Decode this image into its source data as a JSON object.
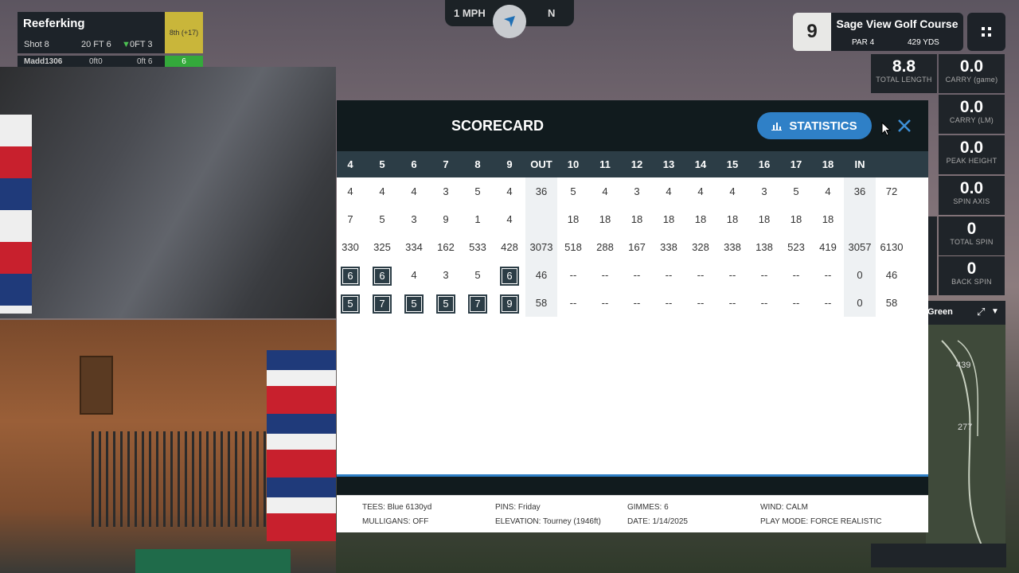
{
  "player_panel": {
    "name": "Reeferking",
    "shot": "Shot 8",
    "distance": "20 FT 6",
    "offset": "0FT 3",
    "place": "8th (+17)",
    "next_player": "Madd1306",
    "next_a": "0ft0",
    "next_b": "0ft 6",
    "next_score": "6"
  },
  "wind": {
    "speed": "1 MPH",
    "direction": "N"
  },
  "hole": {
    "number": "9",
    "course": "Sage View Golf Course",
    "par": "PAR 4",
    "yards": "429 YDS"
  },
  "shot_stats": [
    {
      "value": "8.8",
      "label": "TOTAL LENGTH"
    },
    {
      "value": "0.0",
      "label": "CARRY (game)"
    },
    {
      "value": "0.0",
      "label": "CARRY (LM)"
    },
    {
      "value": "0.0",
      "label": "PEAK HEIGHT"
    },
    {
      "value": "0.0",
      "label": "SPIN AXIS"
    },
    {
      "value": "0",
      "label": "TOTAL SPIN"
    },
    {
      "value": "0",
      "label": "BACK SPIN"
    }
  ],
  "map": {
    "label": "Green",
    "dist1": "439",
    "dist2": "277"
  },
  "scorecard": {
    "title": "SCORECARD",
    "statistics_label": "STATISTICS",
    "headers": [
      "4",
      "5",
      "6",
      "7",
      "8",
      "9",
      "OUT",
      "10",
      "11",
      "12",
      "13",
      "14",
      "15",
      "16",
      "17",
      "18",
      "IN",
      ""
    ],
    "rows": [
      [
        "4",
        "4",
        "4",
        "3",
        "5",
        "4",
        "36",
        "5",
        "4",
        "3",
        "4",
        "4",
        "4",
        "3",
        "5",
        "4",
        "36",
        "72"
      ],
      [
        "7",
        "5",
        "3",
        "9",
        "1",
        "4",
        "",
        "18",
        "18",
        "18",
        "18",
        "18",
        "18",
        "18",
        "18",
        "18",
        "",
        ""
      ],
      [
        "330",
        "325",
        "334",
        "162",
        "533",
        "428",
        "3073",
        "518",
        "288",
        "167",
        "338",
        "328",
        "338",
        "138",
        "523",
        "419",
        "3057",
        "6130"
      ],
      [
        "6",
        "6",
        "4",
        "3",
        "5",
        "6",
        "46",
        "--",
        "--",
        "--",
        "--",
        "--",
        "--",
        "--",
        "--",
        "--",
        "0",
        "46"
      ],
      [
        "5",
        "7",
        "5",
        "5",
        "7",
        "9",
        "58",
        "--",
        "--",
        "--",
        "--",
        "--",
        "--",
        "--",
        "--",
        "--",
        "0",
        "58"
      ]
    ],
    "boxed": [
      [
        3,
        0
      ],
      [
        3,
        1
      ],
      [
        3,
        5
      ],
      [
        4,
        0
      ],
      [
        4,
        1
      ],
      [
        4,
        2
      ],
      [
        4,
        3
      ],
      [
        4,
        4
      ],
      [
        4,
        5
      ]
    ],
    "footer": {
      "tees": "TEES: Blue 6130yd",
      "mulligans": "MULLIGANS: OFF",
      "pins": "PINS: Friday",
      "elevation": "ELEVATION: Tourney (1946ft)",
      "gimmes": "GIMMES: 6",
      "date": "DATE: 1/14/2025",
      "wind": "WIND: CALM",
      "play_mode": "PLAY MODE: FORCE REALISTIC"
    }
  },
  "colors": {
    "accent": "#2f80c7",
    "header": "#2c3d46",
    "dark": "#111b1e",
    "place": "#c9b63a",
    "green": "#34a93b"
  }
}
